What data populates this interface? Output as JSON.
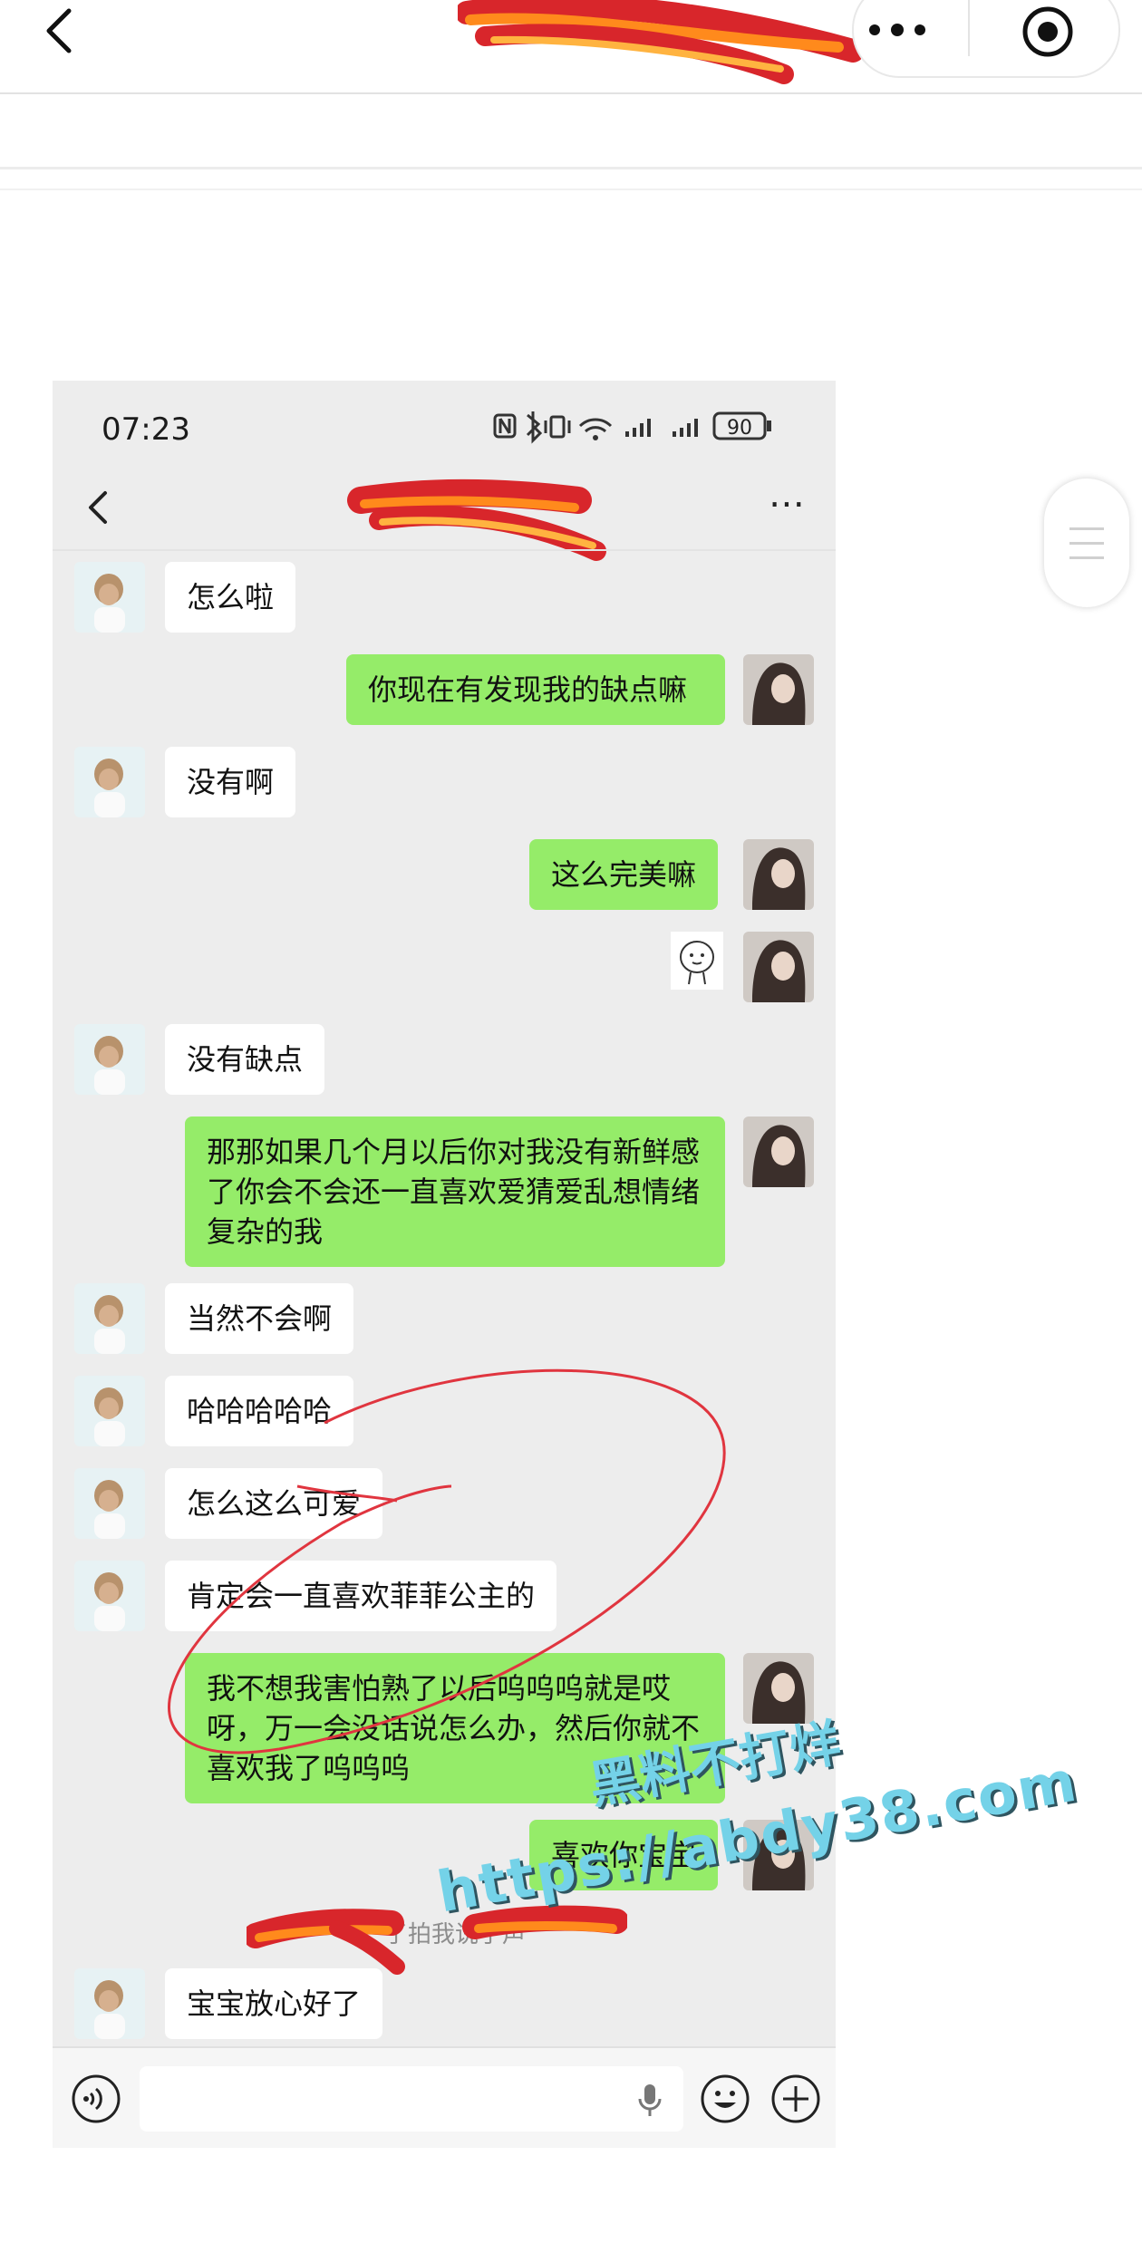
{
  "status_bar": {
    "time": "07:23",
    "battery": "90"
  },
  "messages": [
    {
      "side": "in",
      "text": "怎么啦"
    },
    {
      "side": "out",
      "text": "你现在有发现我的缺点嘛"
    },
    {
      "side": "in",
      "text": "没有啊"
    },
    {
      "side": "out",
      "text": "这么完美嘛"
    },
    {
      "side": "in",
      "text": "没有缺点"
    },
    {
      "side": "out",
      "text": "那那如果几个月以后你对我没有新鲜感了你会不会还一直喜欢爱猜爱乱想情绪复杂的我"
    },
    {
      "side": "in",
      "text": "当然不会啊"
    },
    {
      "side": "in",
      "text": "哈哈哈哈哈"
    },
    {
      "side": "in",
      "text": "怎么这么可爱"
    },
    {
      "side": "in",
      "text": "肯定会一直喜欢菲菲公主的"
    },
    {
      "side": "out",
      "text": "我不想我害怕熟了以后呜呜呜就是哎呀，万一会没话说怎么办，然后你就不喜欢我了呜呜呜"
    },
    {
      "side": "out",
      "text": "喜欢你宝宝"
    },
    {
      "side": "in",
      "text": "宝宝放心好了"
    }
  ],
  "system_note": "了拍我说了声",
  "watermark": {
    "line1": "黑料不打烊",
    "line2": "https://abdy38.com"
  },
  "colors": {
    "bubble_out": "#95ec69",
    "bubble_in": "#ffffff",
    "chat_bg": "#ededed",
    "scribble_red": "#d8262b",
    "scribble_orange": "#ff8a1c"
  },
  "icons": [
    "back-icon",
    "more-icon",
    "target-icon",
    "voice-icon",
    "mic-icon",
    "emoji-icon",
    "add-icon"
  ]
}
